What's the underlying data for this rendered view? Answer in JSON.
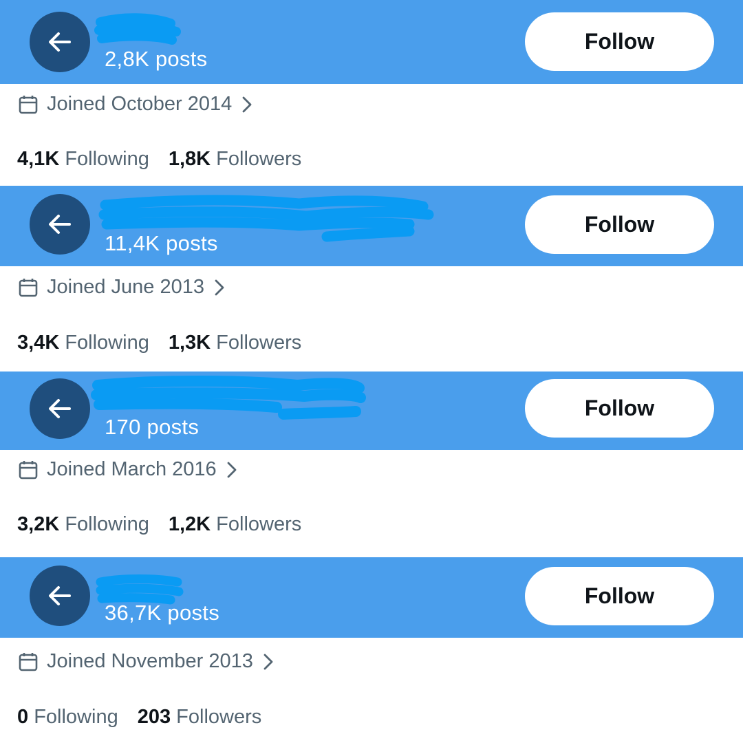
{
  "colors": {
    "header_bg": "#4a9eec",
    "back_button_bg": "#1f4e7d",
    "redaction_scribble": "#0a9bf3",
    "follow_button_bg": "#ffffff",
    "secondary_text": "#536471",
    "primary_text": "#0f1419"
  },
  "profiles": [
    {
      "posts": "2,8K posts",
      "follow_label": "Follow",
      "joined": "Joined October 2014",
      "following_count": "4,1K",
      "following_label": "Following",
      "followers_count": "1,8K",
      "followers_label": "Followers"
    },
    {
      "posts": "11,4K posts",
      "follow_label": "Follow",
      "joined": "Joined June 2013",
      "following_count": "3,4K",
      "following_label": "Following",
      "followers_count": "1,3K",
      "followers_label": "Followers"
    },
    {
      "posts": "170 posts",
      "follow_label": "Follow",
      "joined": "Joined March 2016",
      "following_count": "3,2K",
      "following_label": "Following",
      "followers_count": "1,2K",
      "followers_label": "Followers"
    },
    {
      "posts": "36,7K posts",
      "follow_label": "Follow",
      "joined": "Joined November 2013",
      "following_count": "0",
      "following_label": "Following",
      "followers_count": "203",
      "followers_label": "Followers"
    }
  ],
  "icons": {
    "back": "arrow-left-icon",
    "calendar": "calendar-icon",
    "chevron": "chevron-right-icon"
  }
}
